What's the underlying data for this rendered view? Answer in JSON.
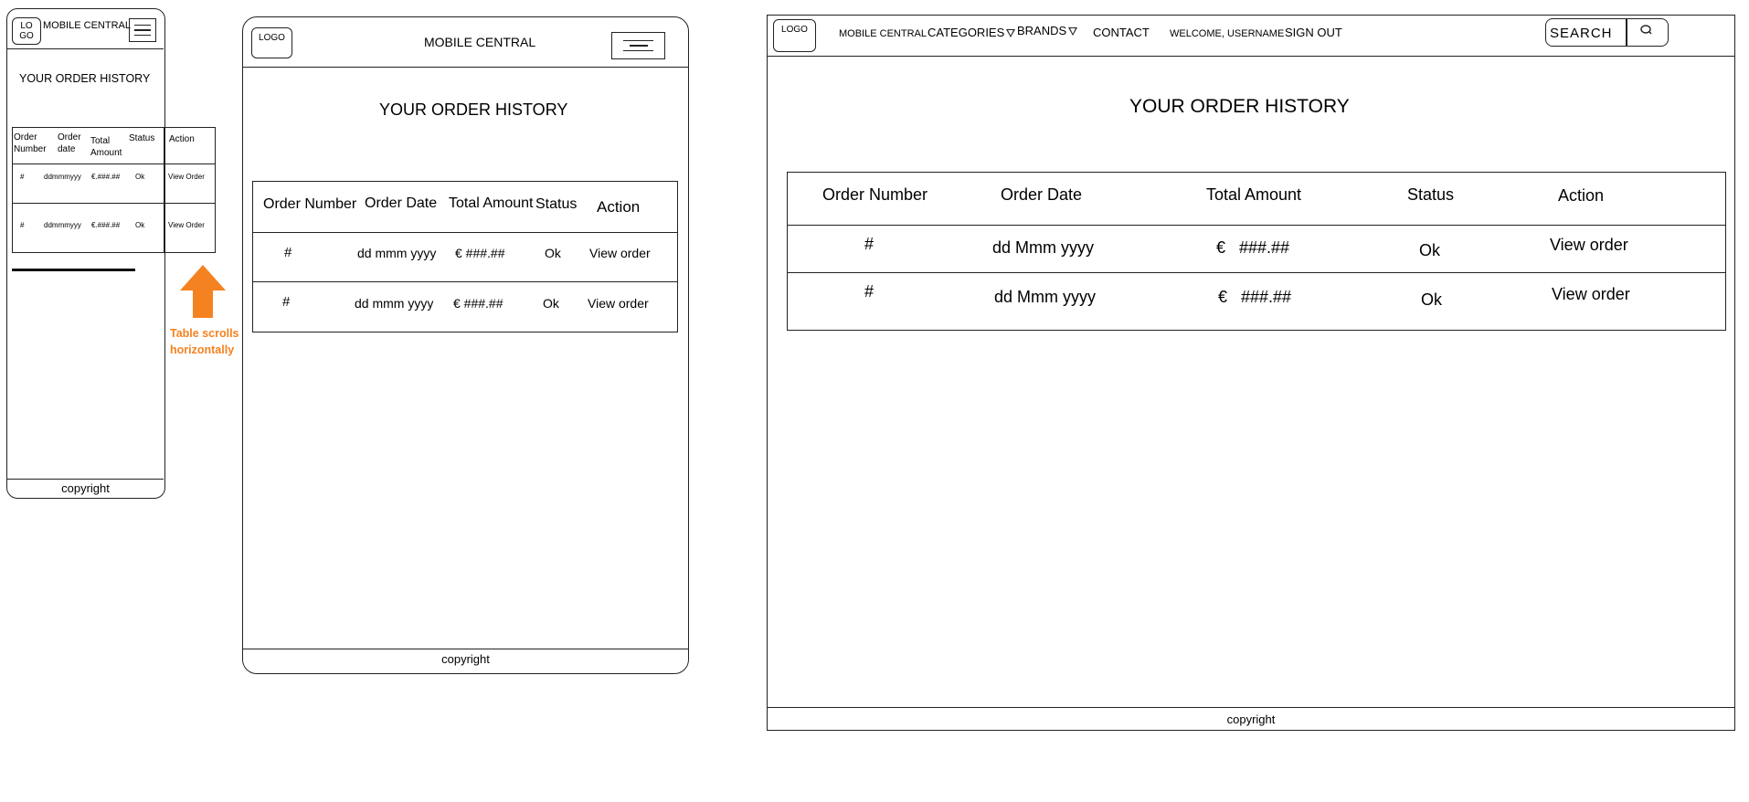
{
  "mobile": {
    "logo": "LO GO",
    "brand": "MOBILE CENTRAL",
    "title": "YOUR ORDER HISTORY",
    "headers": [
      "Order Number",
      "Order date",
      "Total Amount",
      "Status",
      "Action"
    ],
    "rows": [
      [
        "#",
        "ddmmmyyy",
        "€.###.##",
        "Ok",
        "View Order"
      ],
      [
        "#",
        "ddmmmyyy",
        "€.###.##",
        "Ok",
        "View Order"
      ]
    ],
    "annotation": "Table scrolls horizontally",
    "footer": "copyright"
  },
  "tablet": {
    "logo": "LOGO",
    "brand": "MOBILE CENTRAL",
    "title": "YOUR ORDER HISTORY",
    "headers": [
      "Order Number",
      "Order Date",
      "Total Amount",
      "Status",
      "Action"
    ],
    "rows": [
      [
        "#",
        "dd mmm yyyy",
        "€ ###.##",
        "Ok",
        "View order"
      ],
      [
        "#",
        "dd mmm yyyy",
        "€ ###.##",
        "Ok",
        "View order"
      ]
    ],
    "footer": "copyright"
  },
  "desktop": {
    "logo": "LOGO",
    "nav": {
      "brand": "MOBILE CENTRAL",
      "categories": "CATEGORIES",
      "brands": "BRANDS",
      "contact": "CONTACT",
      "welcome": "WELCOME, USERNAME",
      "signout": "SIGN OUT"
    },
    "search_placeholder": "SEARCH",
    "title": "YOUR ORDER HISTORY",
    "headers": [
      "Order Number",
      "Order Date",
      "Total Amount",
      "Status",
      "Action"
    ],
    "rows": [
      [
        "#",
        "dd Mmm yyyy",
        "€   ###.##",
        "Ok",
        "View order"
      ],
      [
        "#",
        "dd Mmm yyyy",
        "€   ###.##",
        "Ok",
        "View order"
      ]
    ],
    "footer": "copyright"
  },
  "colors": {
    "accent": "#f58220",
    "line": "#222222"
  }
}
